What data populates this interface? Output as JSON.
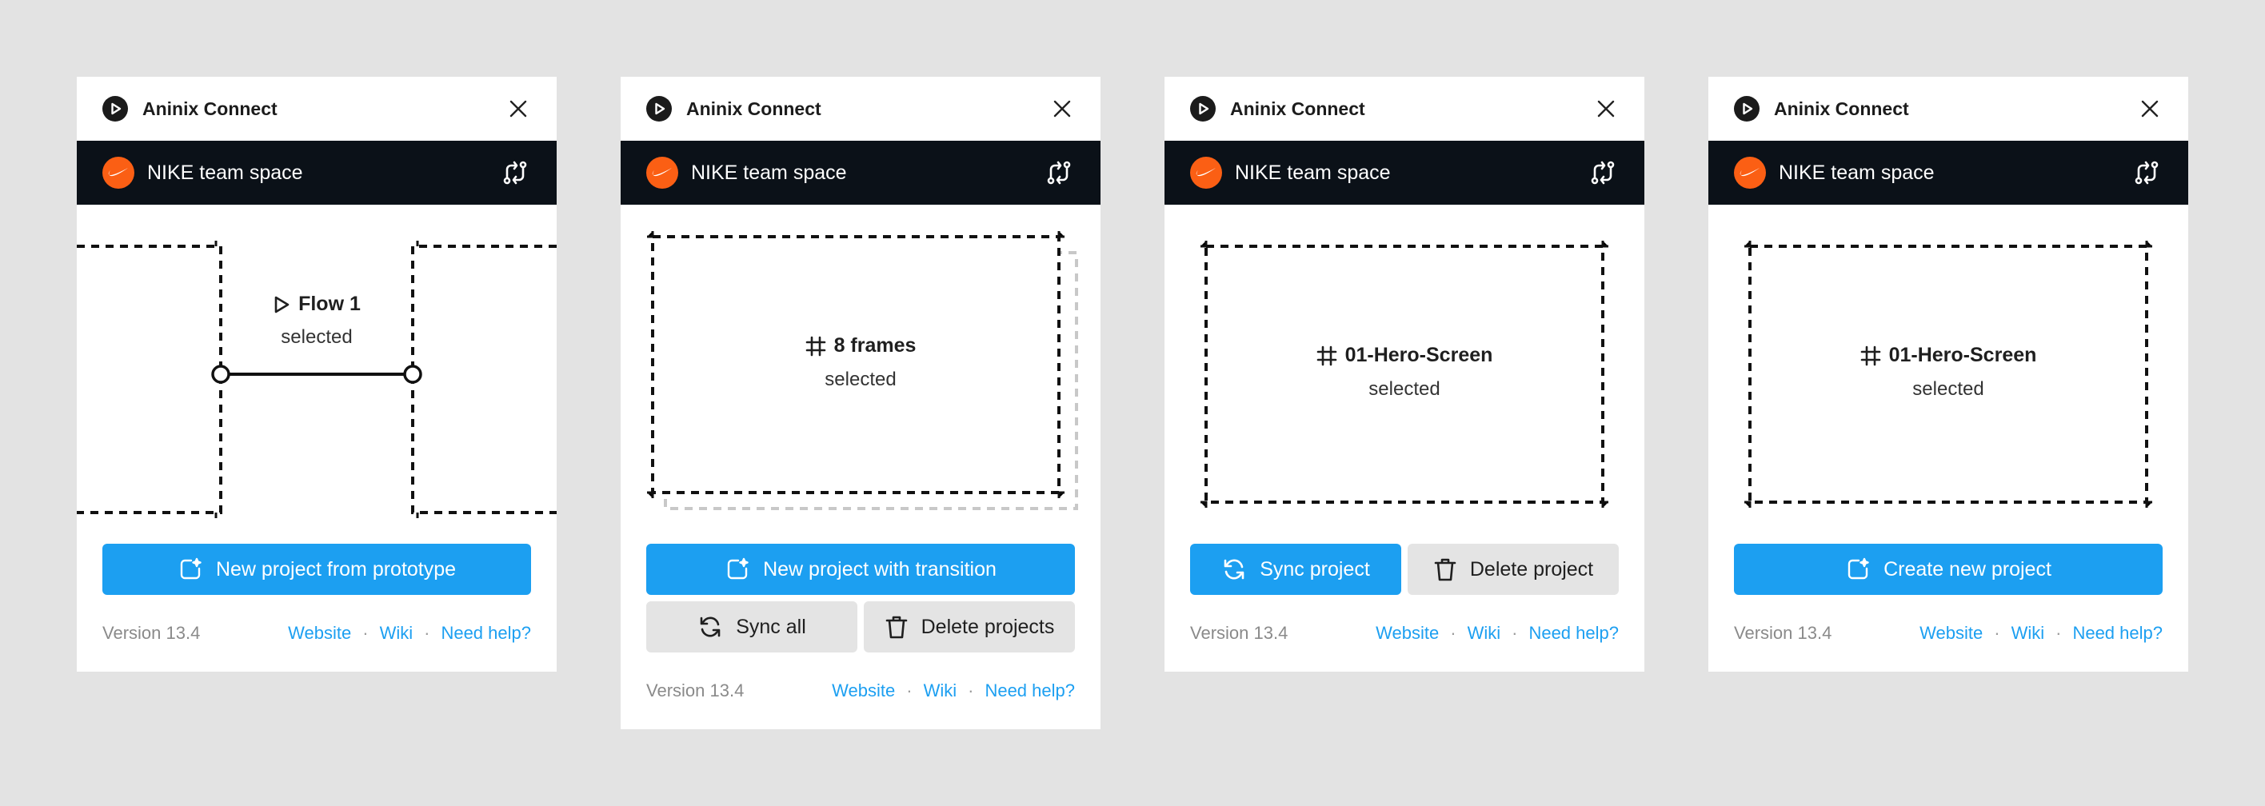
{
  "app": {
    "title": "Aninix Connect"
  },
  "team": {
    "name": "NIKE team space"
  },
  "colors": {
    "accent": "#1c9ff1",
    "team_bar": "#0b1118",
    "team_logo": "#fb5f14",
    "secondary_button": "#e4e4e4"
  },
  "footer": {
    "version": "Version 13.4",
    "website": "Website",
    "wiki": "Wiki",
    "help": "Need help?",
    "separator": "·"
  },
  "panels": [
    {
      "selection": {
        "name": "Flow 1",
        "sub": "selected",
        "icon": "play-outline-icon"
      },
      "actions": [
        {
          "label": "New project from prototype",
          "icon": "new-project-icon"
        }
      ]
    },
    {
      "selection": {
        "name": "8 frames",
        "sub": "selected",
        "icon": "frame-icon"
      },
      "actions": [
        {
          "label": "New project with transition",
          "icon": "new-project-icon"
        },
        {
          "label": "Sync all",
          "icon": "sync-icon"
        },
        {
          "label": "Delete projects",
          "icon": "trash-icon"
        }
      ]
    },
    {
      "selection": {
        "name": "01-Hero-Screen",
        "sub": "selected",
        "icon": "frame-icon"
      },
      "actions": [
        {
          "label": "Sync project",
          "icon": "sync-icon"
        },
        {
          "label": "Delete project",
          "icon": "trash-icon"
        }
      ]
    },
    {
      "selection": {
        "name": "01-Hero-Screen",
        "sub": "selected",
        "icon": "frame-icon"
      },
      "actions": [
        {
          "label": "Create new project",
          "icon": "new-project-icon"
        }
      ]
    }
  ]
}
